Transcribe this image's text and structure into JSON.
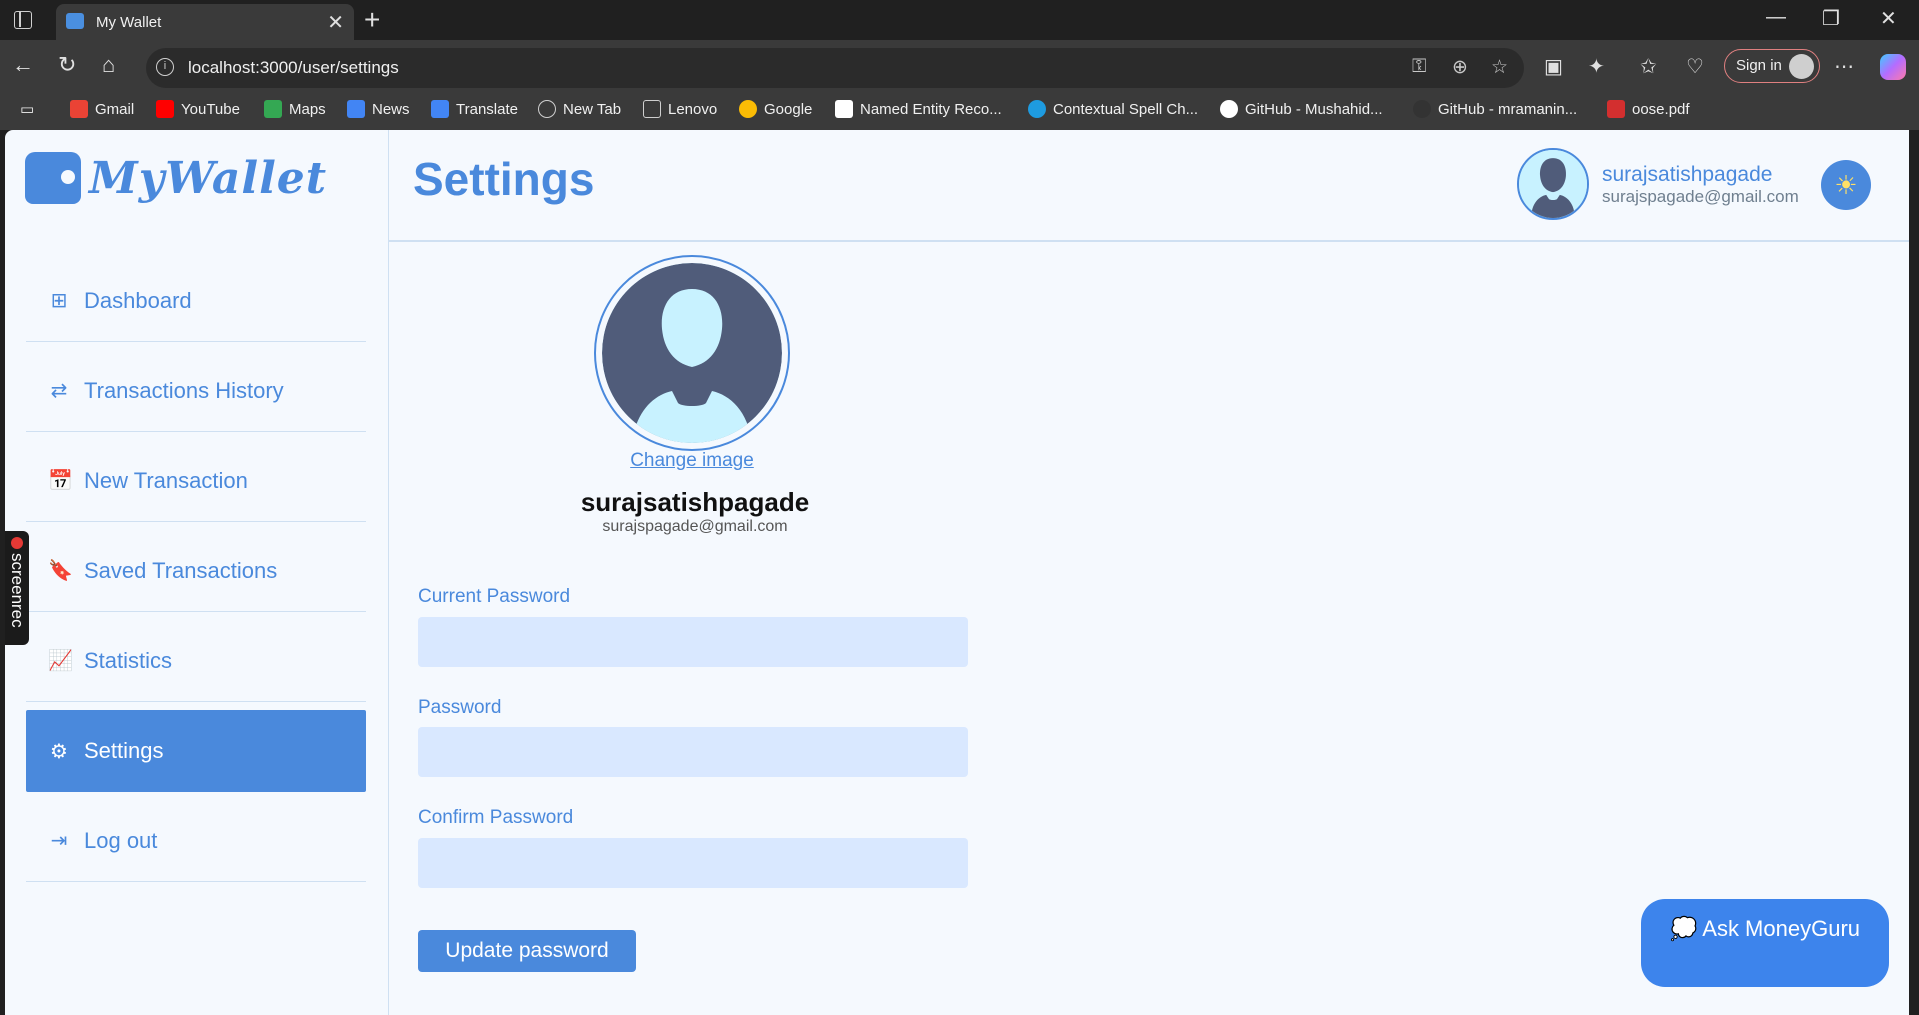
{
  "browser": {
    "tab_title": "My Wallet",
    "tab_close": "✕",
    "new_tab": "+",
    "url": "localhost:3000/user/settings",
    "signin_label": "Sign in",
    "bookmarks": [
      {
        "label": "Gmail",
        "color": "#ea4335"
      },
      {
        "label": "YouTube",
        "color": "#ff0000"
      },
      {
        "label": "Maps",
        "color": "#34a853"
      },
      {
        "label": "News",
        "color": "#4285f4"
      },
      {
        "label": "Translate",
        "color": "#4285f4"
      },
      {
        "label": "New Tab",
        "color": "#9e9e9e"
      },
      {
        "label": "Lenovo",
        "color": "#9e9e9e"
      },
      {
        "label": "Google",
        "color": "#fbbc05"
      },
      {
        "label": "Named Entity Reco...",
        "color": "#ffffff"
      },
      {
        "label": "Contextual Spell Ch...",
        "color": "#1e9be0"
      },
      {
        "label": "GitHub - Mushahid...",
        "color": "#ffffff"
      },
      {
        "label": "GitHub - mramanin...",
        "color": "#333333"
      },
      {
        "label": "oose.pdf",
        "color": "#d32f2f"
      }
    ]
  },
  "app": {
    "logo_text": "MyWallet",
    "page_title": "Settings",
    "menu": [
      {
        "label": "Dashboard",
        "icon": "⊞"
      },
      {
        "label": "Transactions History",
        "icon": "⇄"
      },
      {
        "label": "New Transaction",
        "icon": "📅"
      },
      {
        "label": "Saved Transactions",
        "icon": "🔖"
      },
      {
        "label": "Statistics",
        "icon": "📈"
      },
      {
        "label": "Settings",
        "icon": "⚙"
      },
      {
        "label": "Log out",
        "icon": "⇥"
      }
    ],
    "active_menu": "Settings",
    "user": {
      "username": "surajsatishpagade",
      "email": "surajspagade@gmail.com"
    },
    "profile": {
      "change_image": "Change image",
      "username": "surajsatishpagade",
      "email": "surajspagade@gmail.com"
    },
    "form": {
      "current_password_label": "Current Password",
      "password_label": "Password",
      "confirm_password_label": "Confirm Password",
      "current_password_value": "",
      "password_value": "",
      "confirm_password_value": "",
      "update_button": "Update password"
    },
    "ask_button": "💭 Ask MoneyGuru",
    "screenrec_label": "screenrec",
    "accent_color": "#4a89dc"
  }
}
